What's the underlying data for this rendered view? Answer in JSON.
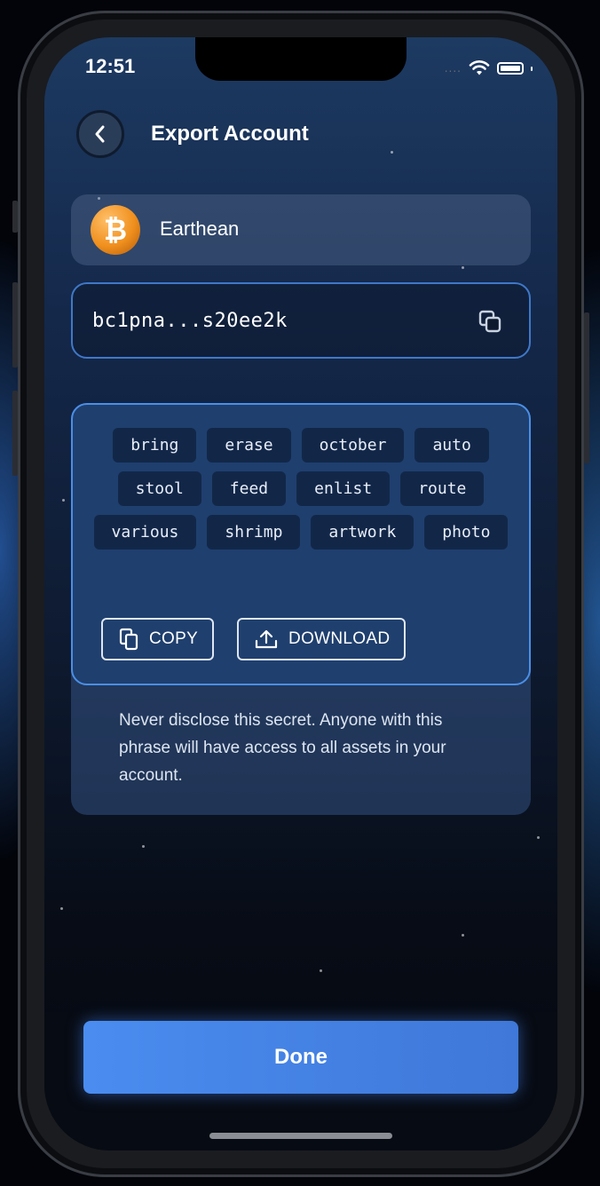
{
  "status_bar": {
    "time": "12:51",
    "signal": "...."
  },
  "header": {
    "title": "Export Account",
    "back_icon": "chevron-left-icon"
  },
  "account": {
    "name": "Earthean",
    "icon": "bitcoin-icon",
    "symbol": "₿"
  },
  "address": {
    "value": "bc1pna...s20ee2k",
    "copy_icon": "copy-icon"
  },
  "recovery_phrase": {
    "words": [
      "bring",
      "erase",
      "october",
      "auto",
      "stool",
      "feed",
      "enlist",
      "route",
      "various",
      "shrimp",
      "artwork",
      "photo"
    ],
    "copy_label": "COPY",
    "download_label": "DOWNLOAD"
  },
  "warning_text": "Never disclose this secret. Anyone with this phrase will have access to all assets in your account.",
  "done_label": "Done",
  "colors": {
    "accent": "#4a8cf0",
    "border_accent": "#4a8fe8",
    "btc": "#f0901e"
  }
}
